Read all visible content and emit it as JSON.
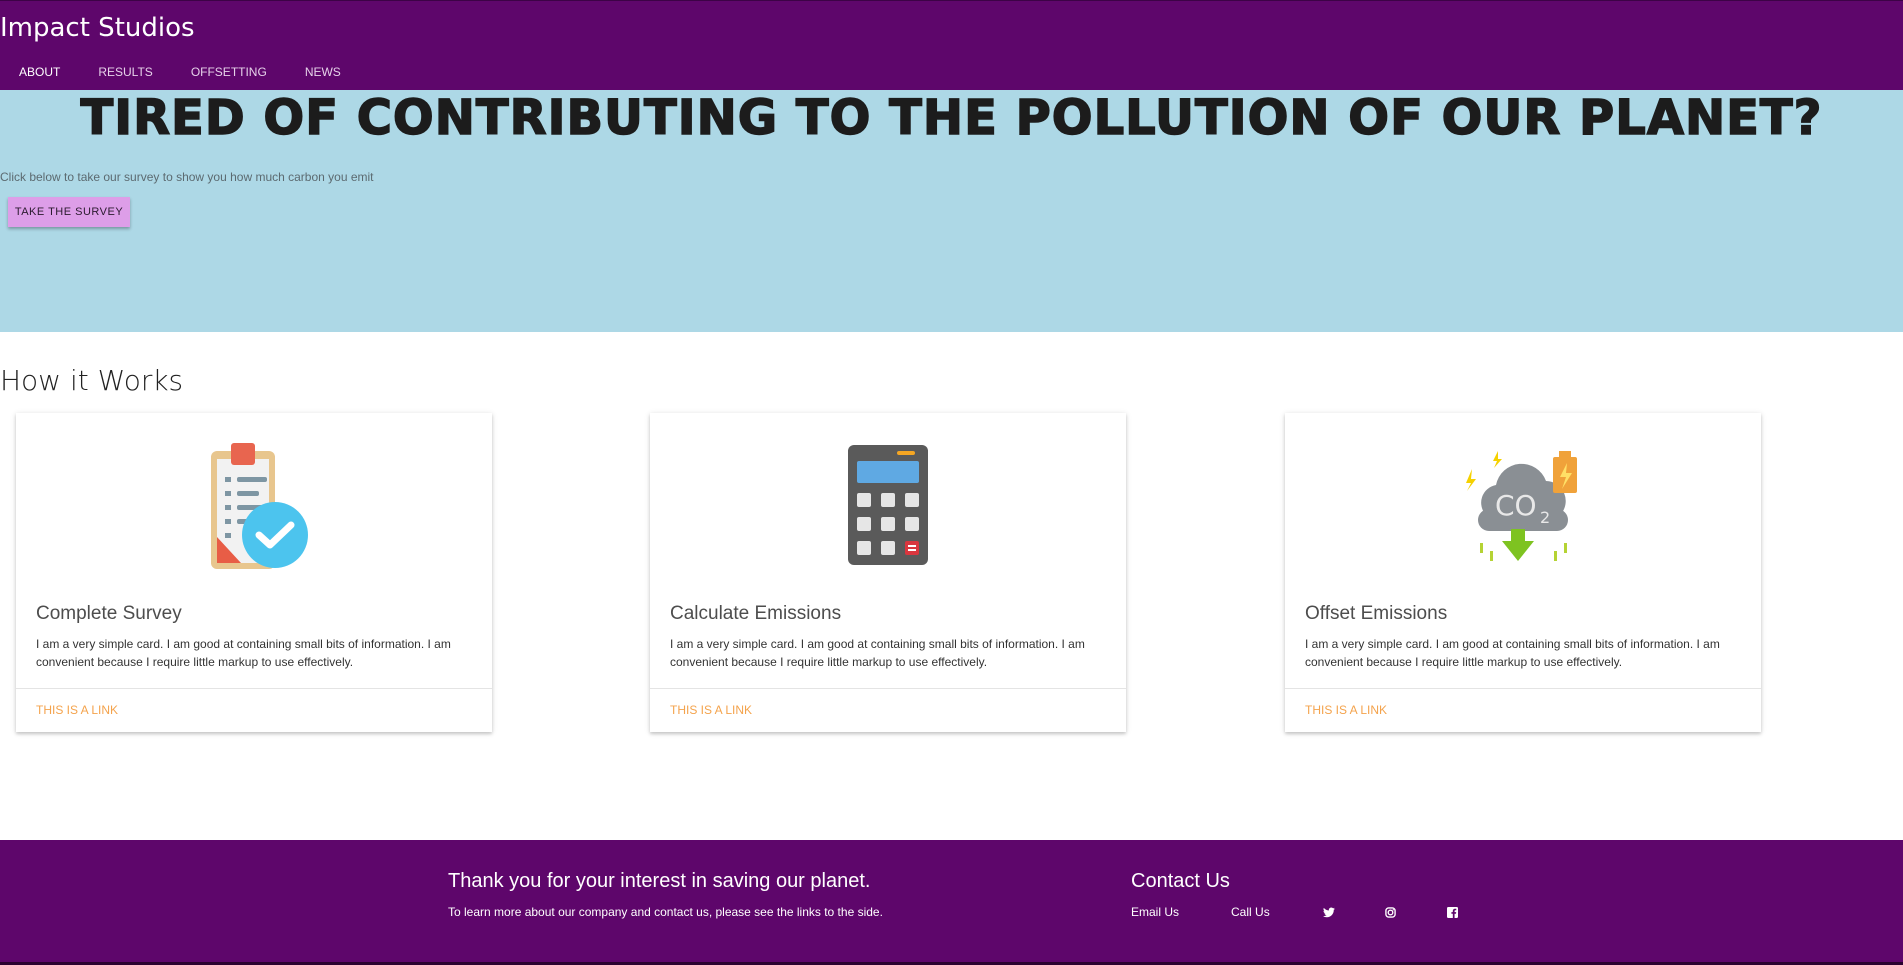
{
  "app": {
    "brand": "Impact Studios"
  },
  "nav": {
    "items": [
      {
        "label": "ABOUT",
        "active": true
      },
      {
        "label": "RESULTS",
        "active": false
      },
      {
        "label": "OFFSETTING",
        "active": false
      },
      {
        "label": "NEWS",
        "active": false
      }
    ]
  },
  "hero": {
    "title": "TIRED OF CONTRIBUTING TO THE POLLUTION OF OUR PLANET?",
    "subtitle": "Click below to take our survey to show you how much carbon you emit",
    "button_label": "TAKE THE SURVEY"
  },
  "section": {
    "title": "How it Works"
  },
  "cards": [
    {
      "icon": "clipboard-check-icon",
      "title": "Complete Survey",
      "text": "I am a very simple card. I am good at containing small bits of information. I am convenient because I require little markup to use effectively.",
      "link": "THIS IS A LINK"
    },
    {
      "icon": "calculator-icon",
      "title": "Calculate Emissions",
      "text": "I am a very simple card. I am good at containing small bits of information. I am convenient because I require little markup to use effectively.",
      "link": "THIS IS A LINK"
    },
    {
      "icon": "co2-cloud-icon",
      "title": "Offset Emissions",
      "text": "I am a very simple card. I am good at containing small bits of information. I am convenient because I require little markup to use effectively.",
      "link": "THIS IS A LINK"
    }
  ],
  "footer": {
    "title": "Thank you for your interest in saving our planet.",
    "text": "To learn more about our company and contact us, please see the links to the side.",
    "contact_title": "Contact Us",
    "email_label": "Email Us",
    "call_label": "Call Us",
    "social": [
      "twitter-icon",
      "instagram-icon",
      "facebook-icon"
    ]
  },
  "colors": {
    "header_bg": "#5e066b",
    "hero_bg": "#add8e6",
    "button_bg": "#dd9ee8",
    "link": "#f4a34c"
  }
}
